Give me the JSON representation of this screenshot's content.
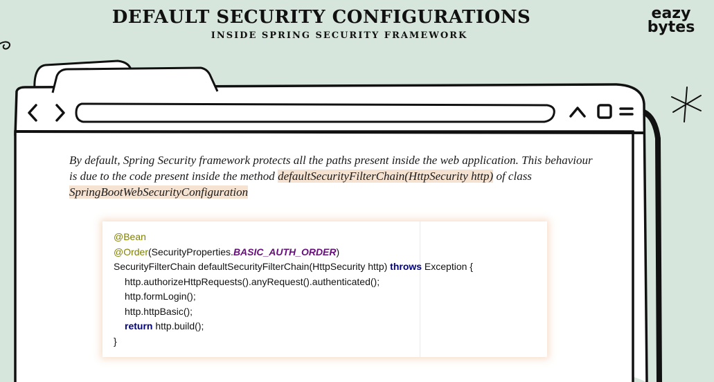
{
  "header": {
    "title": "DEFAULT SECURITY CONFIGURATIONS",
    "subtitle": "INSIDE SPRING SECURITY FRAMEWORK"
  },
  "logo": {
    "line1": "eazy",
    "line2": "bytes"
  },
  "browser": {
    "back_icon": "chevron-left-icon",
    "forward_icon": "chevron-right-icon",
    "controls": [
      "chevron-up-icon",
      "square-icon",
      "menu-icon"
    ]
  },
  "content": {
    "para_part1": "By default, Spring Security framework protects all the paths present inside the web application. This behaviour is due to the code present inside the method ",
    "para_method": "defaultSecurityFilterChain(HttpSecurity http)",
    "para_part2": " of class ",
    "para_class": "SpringBootWebSecurityConfiguration"
  },
  "code": {
    "ann_bean": "@Bean",
    "ann_order": "@Order",
    "order_arg_prefix": "(SecurityProperties.",
    "order_const": "BASIC_AUTH_ORDER",
    "order_arg_suffix": ")",
    "sig_prefix": "SecurityFilterChain defaultSecurityFilterChain(HttpSecurity http) ",
    "kw_throws": "throws",
    "sig_suffix": " Exception {",
    "line_authorize": "http.authorizeHttpRequests().anyRequest().authenticated();",
    "line_formlogin": "http.formLogin();",
    "line_httpbasic": "http.httpBasic();",
    "kw_return": "return",
    "return_rest": " http.build();",
    "close_brace": "}"
  },
  "colors": {
    "background": "#d7e6dc",
    "highlight": "#f6e2d0",
    "annotation": "#808000",
    "keyword": "#000080",
    "constant": "#660e7a"
  }
}
